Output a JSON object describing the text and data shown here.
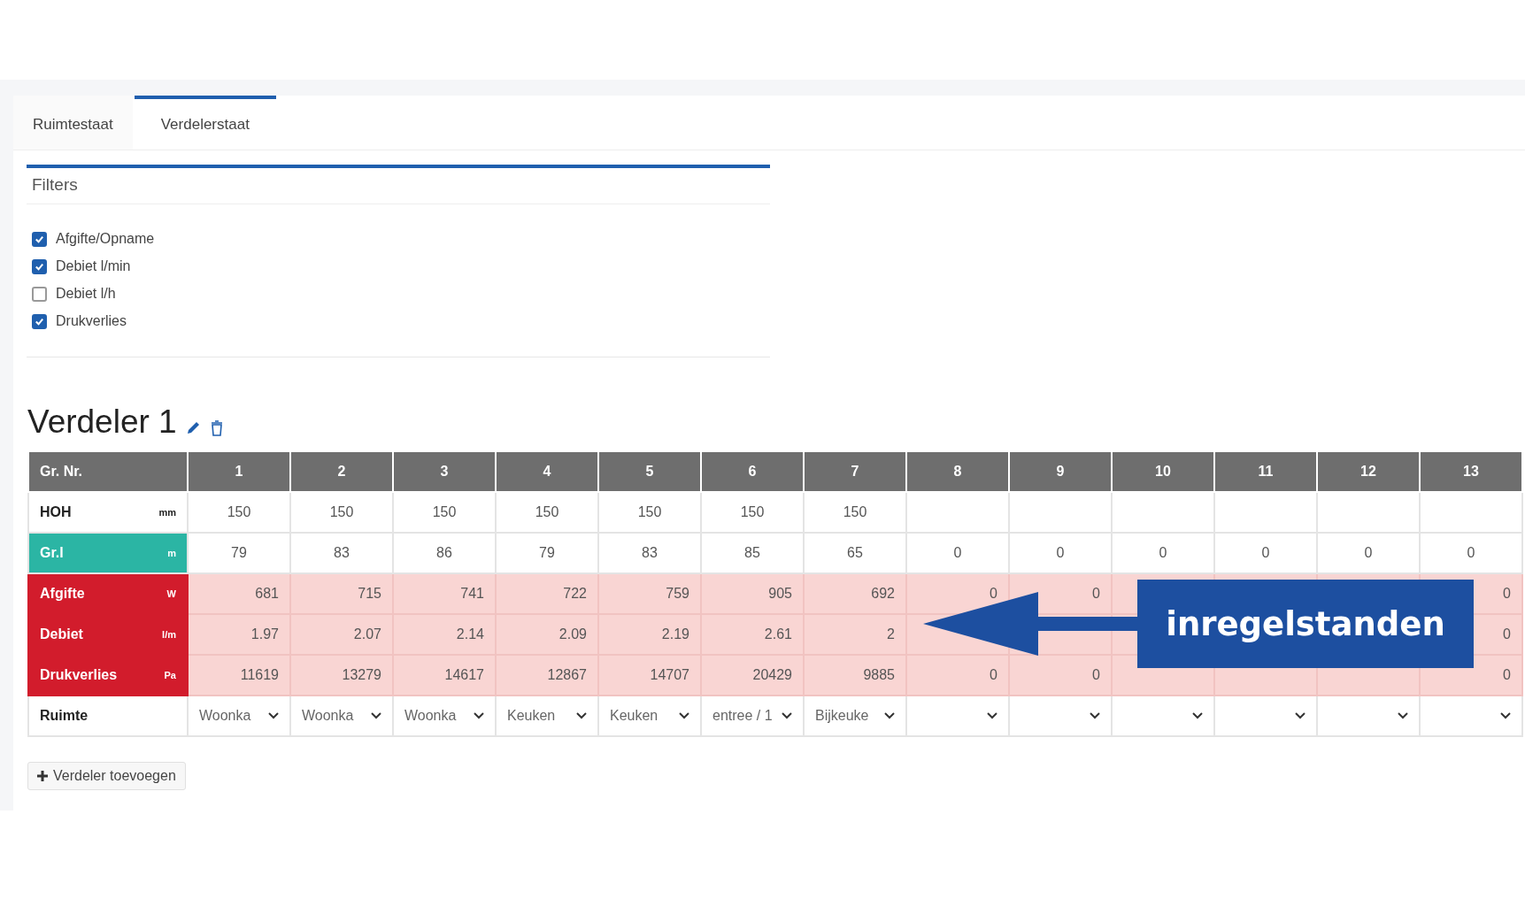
{
  "tabs": [
    {
      "label": "Ruimtestaat",
      "selected": false
    },
    {
      "label": "Verdelerstaat",
      "selected": true
    }
  ],
  "filters": {
    "title": "Filters",
    "options": [
      {
        "label": "Afgifte/Opname",
        "checked": true
      },
      {
        "label": "Debiet l/min",
        "checked": true
      },
      {
        "label": "Debiet l/h",
        "checked": false
      },
      {
        "label": "Drukverlies",
        "checked": true
      }
    ]
  },
  "verdeler": {
    "title": "Verdeler 1",
    "table": {
      "header": "Gr. Nr.",
      "columns": [
        "1",
        "2",
        "3",
        "4",
        "5",
        "6",
        "7",
        "8",
        "9",
        "10",
        "11",
        "12",
        "13"
      ],
      "rows": [
        {
          "kind": "plain",
          "label": "HOH",
          "unit": "mm",
          "cells": [
            "150",
            "150",
            "150",
            "150",
            "150",
            "150",
            "150",
            null,
            null,
            null,
            null,
            null,
            null
          ]
        },
        {
          "kind": "accent",
          "label": "Gr.l",
          "unit": "m",
          "cells": [
            "79",
            "83",
            "86",
            "79",
            "83",
            "85",
            "65",
            "0",
            "0",
            "0",
            "0",
            "0",
            "0"
          ]
        },
        {
          "kind": "alert",
          "label": "Afgifte",
          "unit": "W",
          "cells": [
            "681",
            "715",
            "741",
            "722",
            "759",
            "905",
            "692",
            "0",
            "0",
            null,
            null,
            null,
            "0"
          ]
        },
        {
          "kind": "alert",
          "label": "Debiet",
          "unit": "l/m",
          "cells": [
            "1.97",
            "2.07",
            "2.14",
            "2.09",
            "2.19",
            "2.61",
            "2",
            null,
            null,
            null,
            null,
            null,
            "0"
          ]
        },
        {
          "kind": "alert",
          "label": "Drukverlies",
          "unit": "Pa",
          "cells": [
            "11619",
            "13279",
            "14617",
            "12867",
            "14707",
            "20429",
            "9885",
            "0",
            "0",
            null,
            null,
            null,
            "0"
          ]
        },
        {
          "kind": "select",
          "label": "Ruimte",
          "cells": [
            "Woonka",
            "Woonka",
            "Woonka",
            "Keuken",
            "Keuken",
            "entree / 1",
            "Bijkeuke",
            null,
            null,
            null,
            null,
            null,
            null
          ]
        }
      ]
    }
  },
  "callout": {
    "text": "inregelstanden"
  },
  "add_button": {
    "label": "Verdeler toevoegen"
  }
}
